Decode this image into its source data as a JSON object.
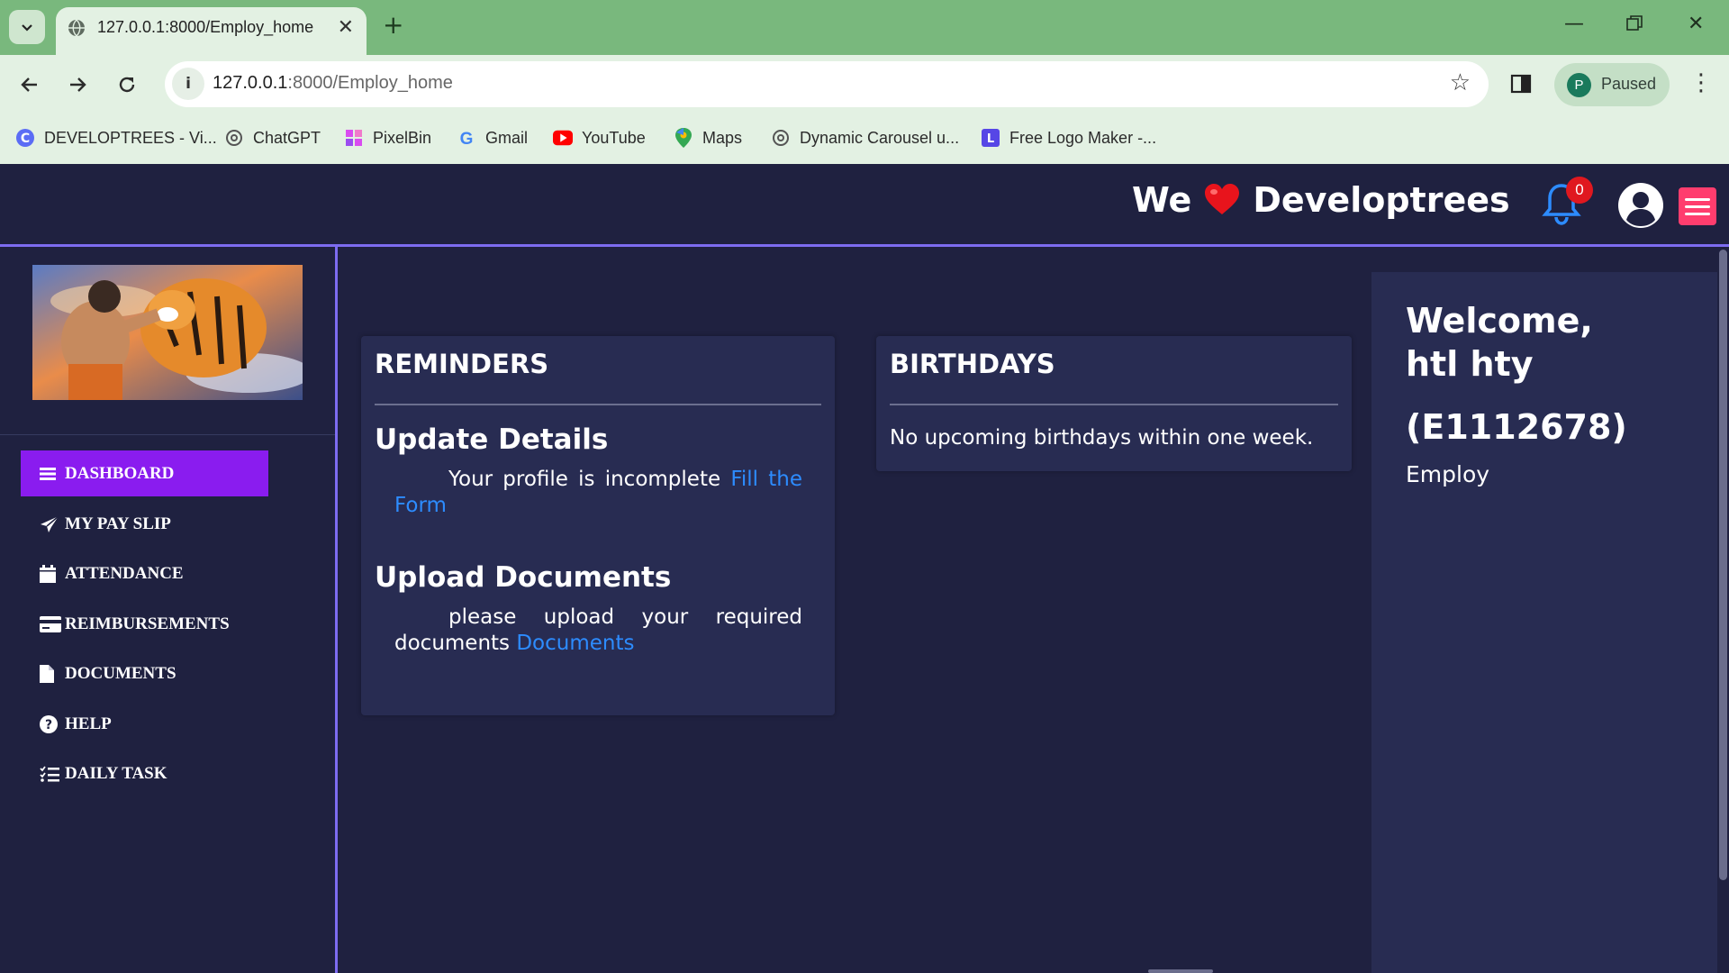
{
  "browser": {
    "tab": {
      "title": "127.0.0.1:8000/Employ_home"
    },
    "url": {
      "host": "127.0.0.1",
      "path": ":8000/Employ_home"
    },
    "profile": {
      "initial": "P",
      "status": "Paused"
    },
    "bookmarks": [
      {
        "label": "DEVELOPTREES - Vi...",
        "icon": "developtrees-icon"
      },
      {
        "label": "ChatGPT",
        "icon": "chatgpt-icon"
      },
      {
        "label": "PixelBin",
        "icon": "pixelbin-icon"
      },
      {
        "label": "Gmail",
        "icon": "google-icon"
      },
      {
        "label": "YouTube",
        "icon": "youtube-icon"
      },
      {
        "label": "Maps",
        "icon": "maps-icon"
      },
      {
        "label": "Dynamic Carousel u...",
        "icon": "chatgpt-icon"
      },
      {
        "label": "Free Logo Maker -...",
        "icon": "logo-maker-icon"
      }
    ]
  },
  "header": {
    "brand_left": "We",
    "brand_right": "Developtrees",
    "notification_count": "0",
    "colors": {
      "accent": "#7d6cf0",
      "menu_button": "#ff3d6e",
      "bell": "#2d8cff",
      "badge": "#e0181f"
    }
  },
  "sidebar": {
    "items": [
      {
        "label": "DASHBOARD",
        "icon": "bars-icon",
        "active": true
      },
      {
        "label": "MY PAY SLIP",
        "icon": "paper-plane-icon"
      },
      {
        "label": "ATTENDANCE",
        "icon": "calendar-icon"
      },
      {
        "label": "REIMBURSEMENTS",
        "icon": "credit-card-icon"
      },
      {
        "label": "DOCUMENTS",
        "icon": "file-icon"
      },
      {
        "label": "HELP",
        "icon": "question-circle-icon"
      },
      {
        "label": "DAILY TASK",
        "icon": "task-list-icon"
      }
    ],
    "active_color": "#8a1cef"
  },
  "reminders": {
    "title": "REMINDERS",
    "update": {
      "heading": "Update Details",
      "text": "Your profile is incomplete",
      "link": "Fill the Form"
    },
    "upload": {
      "heading": "Upload Documents",
      "text": "please upload your required documents",
      "link": "Documents"
    }
  },
  "birthdays": {
    "title": "BIRTHDAYS",
    "message": "No upcoming birthdays within one week."
  },
  "welcome": {
    "greeting": "Welcome,",
    "name": "htl hty",
    "employee_id": "(E1112678)",
    "role": "Employ"
  }
}
